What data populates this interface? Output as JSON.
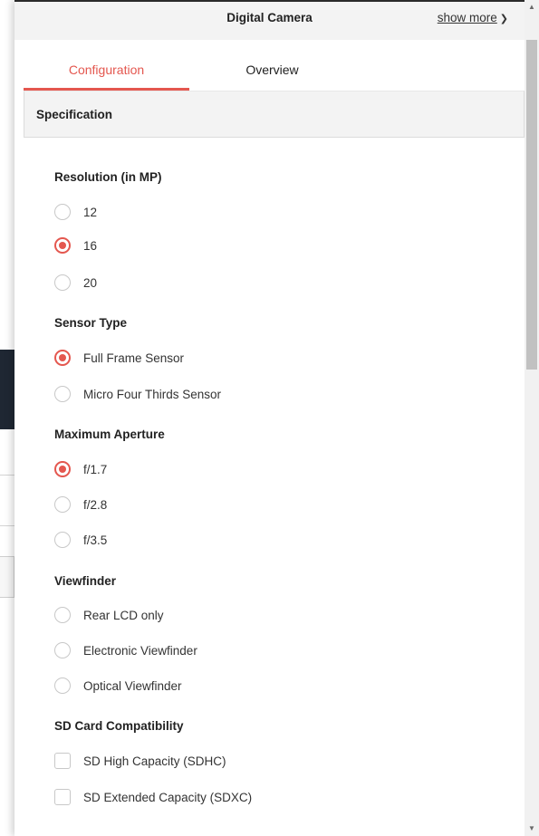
{
  "header": {
    "title": "Digital Camera",
    "show_more": "show more",
    "chevron_icon": "chevron-down-icon"
  },
  "tabs": [
    {
      "label": "Configuration",
      "active": true
    },
    {
      "label": "Overview",
      "active": false
    }
  ],
  "section": {
    "title": "Specification"
  },
  "groups": [
    {
      "title": "Resolution (in MP)",
      "type": "radio",
      "options": [
        {
          "label": "12",
          "selected": false
        },
        {
          "label": "16",
          "selected": true
        },
        {
          "label": "20",
          "selected": false
        }
      ]
    },
    {
      "title": "Sensor Type",
      "type": "radio",
      "options": [
        {
          "label": "Full Frame Sensor",
          "selected": true
        },
        {
          "label": "Micro Four Thirds Sensor",
          "selected": false
        }
      ]
    },
    {
      "title": "Maximum Aperture",
      "type": "radio",
      "options": [
        {
          "label": "f/1.7",
          "selected": true
        },
        {
          "label": "f/2.8",
          "selected": false
        },
        {
          "label": "f/3.5",
          "selected": false
        }
      ]
    },
    {
      "title": "Viewfinder",
      "type": "radio",
      "options": [
        {
          "label": "Rear LCD only",
          "selected": false
        },
        {
          "label": "Electronic Viewfinder",
          "selected": false
        },
        {
          "label": "Optical Viewfinder",
          "selected": false
        }
      ]
    },
    {
      "title": "SD Card Compatibility",
      "type": "checkbox",
      "options": [
        {
          "label": "SD High Capacity (SDHC)",
          "selected": false
        },
        {
          "label": "SD Extended Capacity (SDXC)",
          "selected": false
        }
      ]
    }
  ],
  "colors": {
    "accent": "#e4574f",
    "header_bg": "#f3f3f3"
  }
}
